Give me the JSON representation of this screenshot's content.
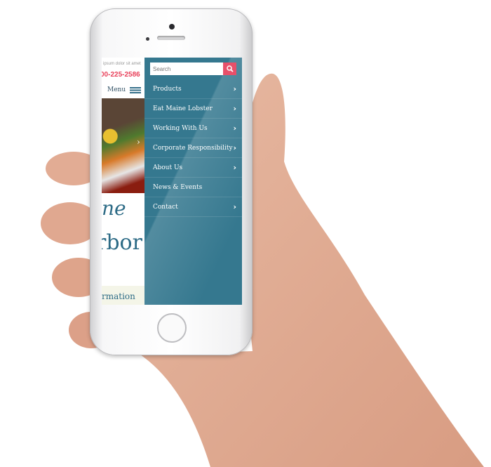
{
  "site": {
    "tagline": "ipsum dolor sit amet",
    "phone": "00-225-2586",
    "menu_label": "Menu",
    "heading_partial_1": "ne",
    "heading_partial_2": "rbor",
    "info_partial": "rmation"
  },
  "drawer": {
    "search_placeholder": "Search",
    "items": [
      {
        "label": "Products",
        "has_submenu": true
      },
      {
        "label": "Eat Maine Lobster",
        "has_submenu": true
      },
      {
        "label": "Working With Us",
        "has_submenu": true
      },
      {
        "label": "Corporate Responsibility",
        "has_submenu": true
      },
      {
        "label": "About Us",
        "has_submenu": true
      },
      {
        "label": "News & Events",
        "has_submenu": false
      },
      {
        "label": "Contact",
        "has_submenu": true
      }
    ]
  },
  "colors": {
    "accent": "#e8506a",
    "drawer": "#35788f",
    "brand_text": "#2d6b86",
    "phone_text": "#e8415a"
  }
}
